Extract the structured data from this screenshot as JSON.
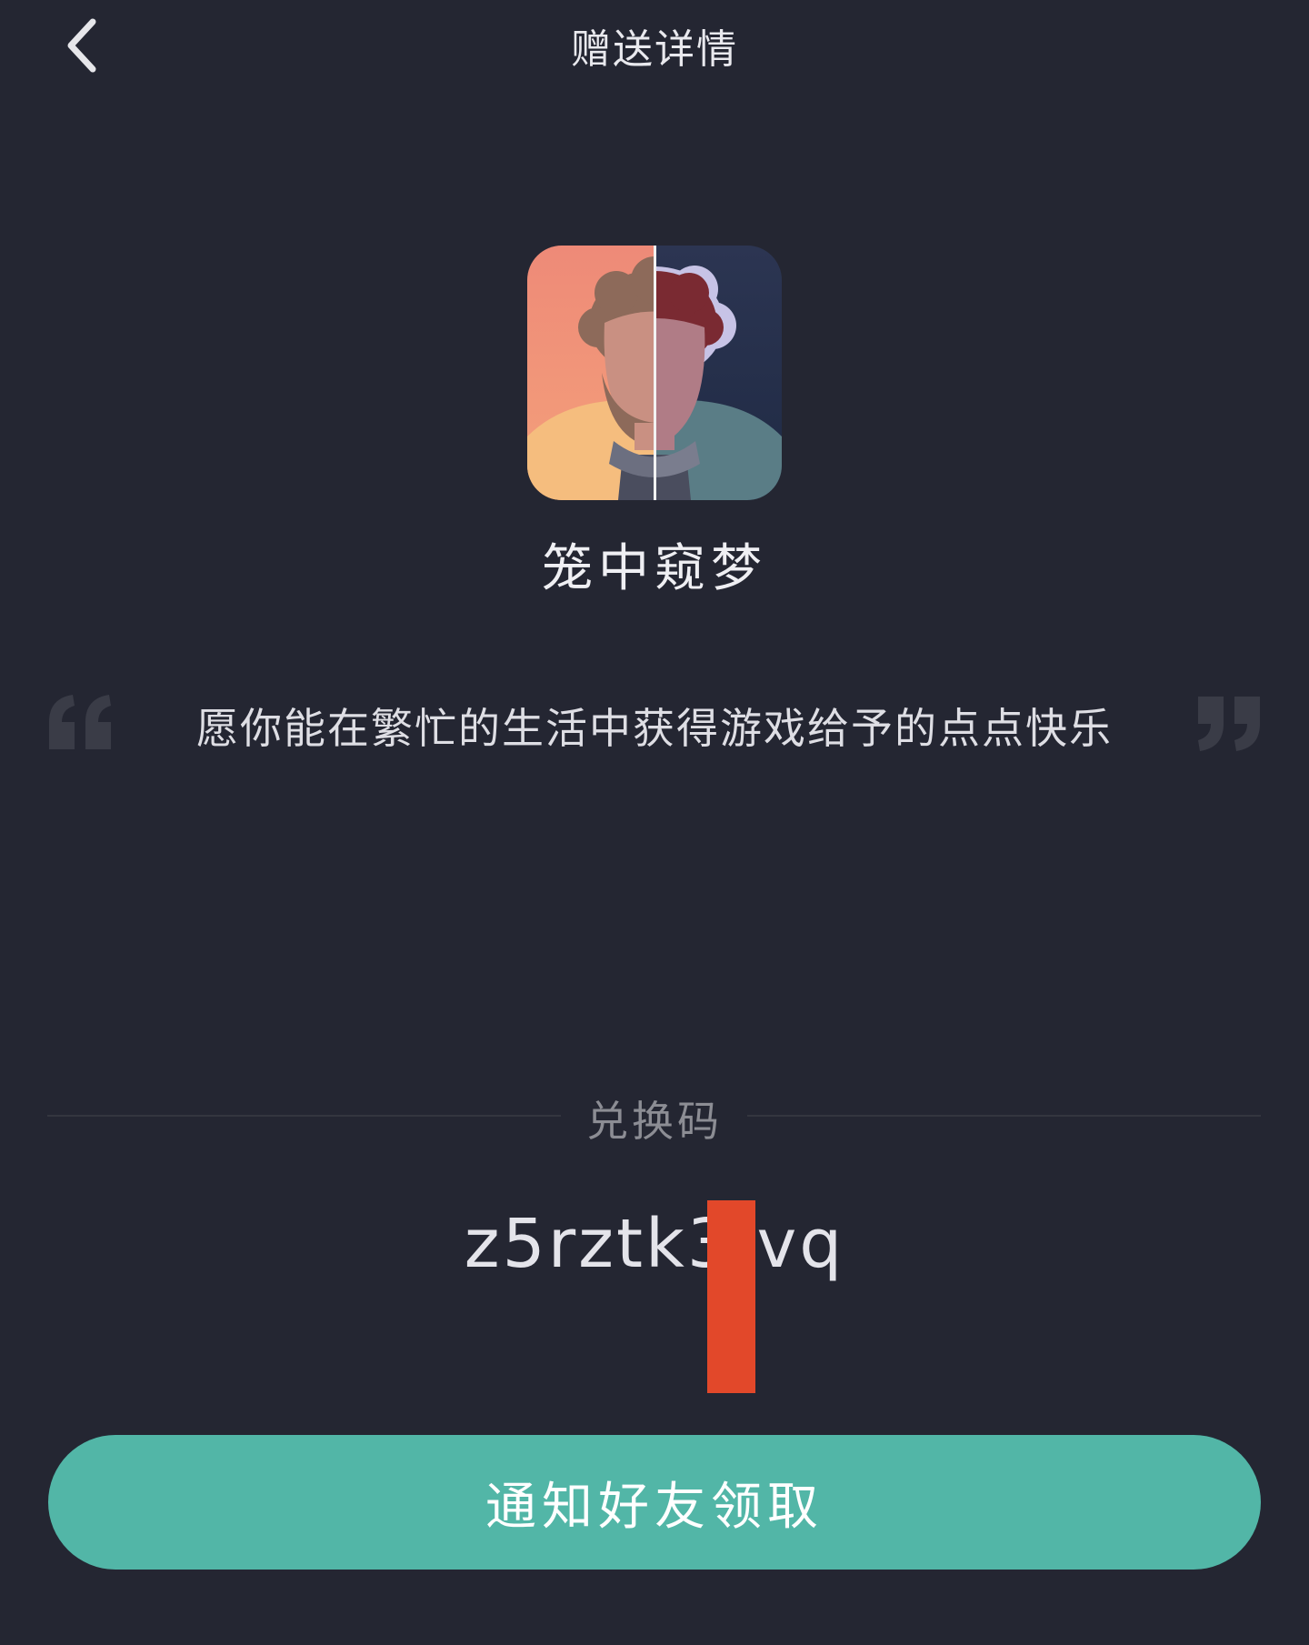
{
  "header": {
    "title": "赠送详情",
    "back_icon": "chevron-left-icon"
  },
  "game": {
    "name": "笼中窥梦",
    "icon": "game-app-icon"
  },
  "message": {
    "text": "愿你能在繁忙的生活中获得游戏给予的点点快乐",
    "open_quote_icon": "quote-open-icon",
    "close_quote_icon": "quote-close-icon"
  },
  "redeem": {
    "label": "兑换码",
    "code": "z5rztk3 vq"
  },
  "actions": {
    "notify_label": "通知好友领取"
  },
  "colors": {
    "background": "#242632",
    "accent": "#52b6a7",
    "redaction": "#e2482a"
  }
}
